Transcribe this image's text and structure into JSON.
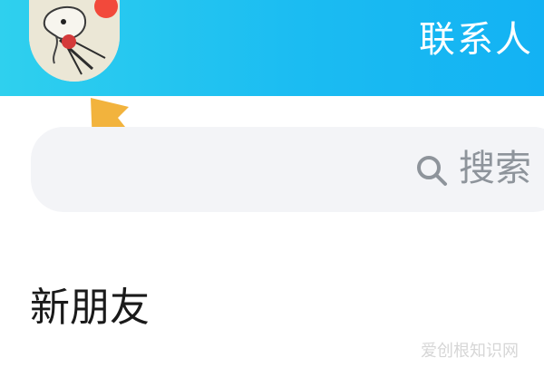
{
  "header": {
    "title": "联系人",
    "avatar_icon": "avatar-cartoon-icon",
    "notification_dot_color": "#f2493b",
    "background_color": "#1bbcf2"
  },
  "annotation": {
    "arrow_icon": "arrow-up-left-icon",
    "arrow_color": "#f2b33d"
  },
  "search": {
    "icon": "search-icon",
    "placeholder": "搜索"
  },
  "sections": {
    "new_friends_label": "新朋友"
  },
  "watermark": {
    "text": "爱创根知识网"
  }
}
